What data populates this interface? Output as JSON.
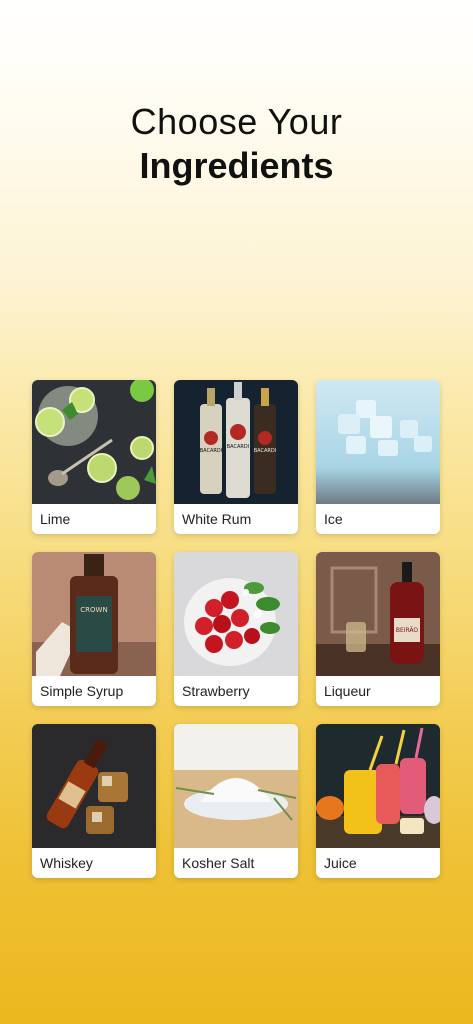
{
  "header": {
    "line1": "Choose Your",
    "line2": "Ingredients"
  },
  "ingredients": [
    {
      "label": "Lime",
      "icon": "lime-icon"
    },
    {
      "label": "White Rum",
      "icon": "rum-bottles-icon"
    },
    {
      "label": "Ice",
      "icon": "ice-icon"
    },
    {
      "label": "Simple Syrup",
      "icon": "syrup-bottle-icon"
    },
    {
      "label": "Strawberry",
      "icon": "strawberry-icon"
    },
    {
      "label": "Liqueur",
      "icon": "liqueur-bottle-icon"
    },
    {
      "label": "Whiskey",
      "icon": "whiskey-icon"
    },
    {
      "label": "Kosher Salt",
      "icon": "salt-icon"
    },
    {
      "label": "Juice",
      "icon": "juice-icon"
    }
  ],
  "bottles_text": {
    "bacardi": "BACARDI",
    "beirao": "BEIRÃO",
    "crown": "CROWN"
  }
}
